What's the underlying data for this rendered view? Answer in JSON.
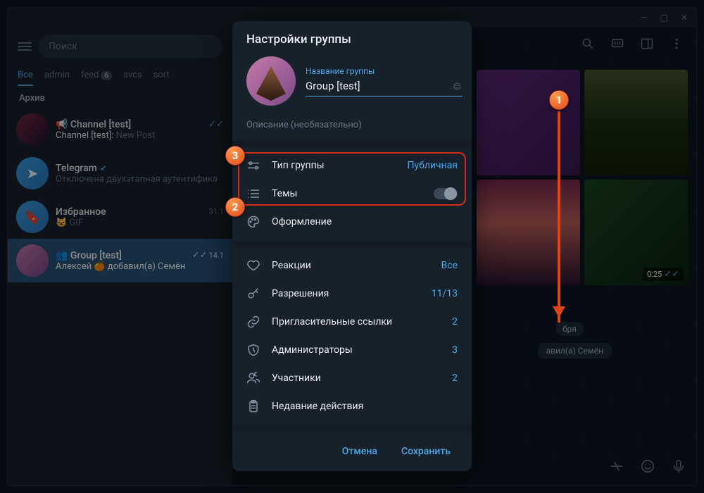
{
  "window": {
    "min": "—",
    "max": "▢",
    "close": "✕"
  },
  "search": {
    "placeholder": "Поиск"
  },
  "folders": [
    {
      "label": "Все",
      "active": true
    },
    {
      "label": "admin"
    },
    {
      "label": "feed",
      "badge": "6"
    },
    {
      "label": "svcs"
    },
    {
      "label": "sort"
    }
  ],
  "archive": "Архив",
  "chats": [
    {
      "name": "Channel [test]",
      "prefix": "📢",
      "sub_a": "Channel [test]:",
      "sub_b": "New Post",
      "checks": "✓✓",
      "avatar_bg": "linear-gradient(135deg,#7a2a40,#1a1030)"
    },
    {
      "name": "Telegram",
      "verified": true,
      "sub": "Отключена двухэтапная аутентифика",
      "avatar_bg": "linear-gradient(135deg,#3aa0e8,#2a7ac0)",
      "glyph": "➤"
    },
    {
      "name": "Избранное",
      "sub_icon": "🐱",
      "sub": "GIF",
      "meta": "31.1",
      "avatar_bg": "linear-gradient(135deg,#3aa0e8,#2a7ac0)",
      "glyph": "🔖"
    },
    {
      "name": "Group [test]",
      "prefix": "👥",
      "sub_a": "Алексей 🍊",
      "sub_b": "добавил(а) Семён",
      "meta": "14.1",
      "checks": "✓✓",
      "selected": true,
      "avatar_bg": "linear-gradient(135deg,#c77aa8,#7a4a8a)"
    }
  ],
  "chat_area": {
    "date": "бря",
    "system_msg": "авил(а) Семён",
    "video_duration": "0:25"
  },
  "modal": {
    "title": "Настройки группы",
    "name_label": "Название группы",
    "name_value": "Group [test]",
    "desc_placeholder": "Описание (необязательно)",
    "rows1": [
      {
        "icon": "sliders",
        "label": "Тип группы",
        "value": "Публичная"
      },
      {
        "icon": "list",
        "label": "Темы",
        "toggle": true
      },
      {
        "icon": "palette",
        "label": "Оформление"
      }
    ],
    "rows2": [
      {
        "icon": "heart",
        "label": "Реакции",
        "value": "Все"
      },
      {
        "icon": "key",
        "label": "Разрешения",
        "value": "11/13"
      },
      {
        "icon": "link",
        "label": "Пригласительные ссылки",
        "value": "2"
      },
      {
        "icon": "shield",
        "label": "Администраторы",
        "value": "3"
      },
      {
        "icon": "users",
        "label": "Участники",
        "value": "2"
      },
      {
        "icon": "clipboard",
        "label": "Недавние действия"
      }
    ],
    "cancel": "Отмена",
    "save": "Сохранить"
  },
  "callouts": {
    "1": "1",
    "2": "2",
    "3": "3"
  }
}
